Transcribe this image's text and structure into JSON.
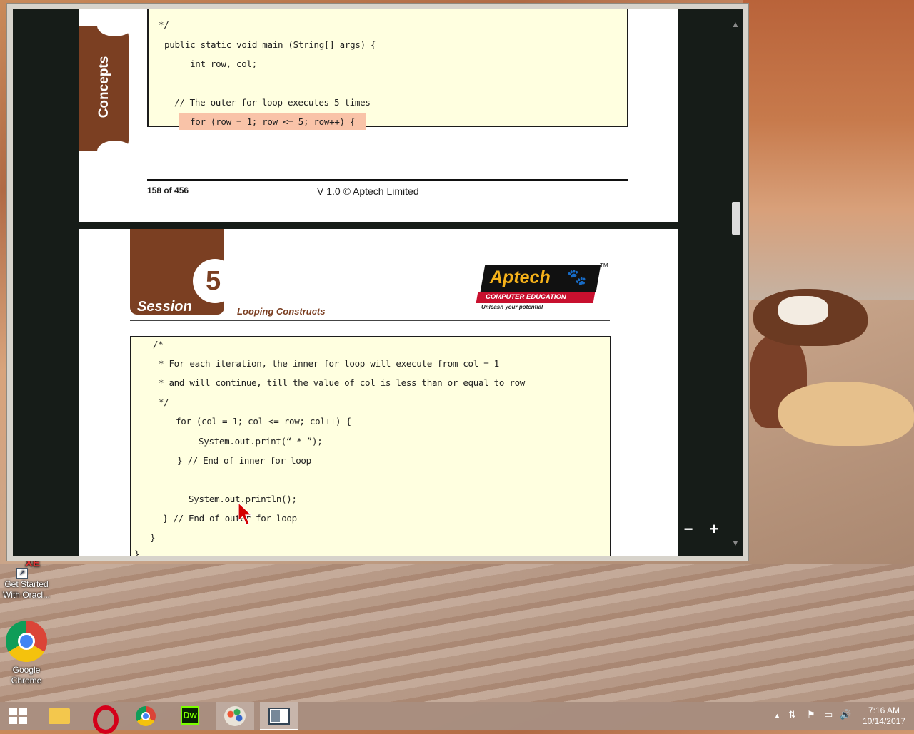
{
  "desktop": {
    "icons": [
      {
        "label_line1": "Get Started",
        "label_line2": "With Oracl..."
      },
      {
        "label_line1": "Google",
        "label_line2": "Chrome"
      }
    ],
    "oracle_badge": "XE"
  },
  "viewer": {
    "zoom_out_label": "−",
    "zoom_in_label": "+",
    "scroll_up": "▲",
    "scroll_down": "▼"
  },
  "page1": {
    "side_tab": "Concepts",
    "code_lines": [
      "*/",
      "public static void main (String[] args) {",
      "int row, col;",
      "// The outer for loop executes 5 times",
      "for (row = 1; row <= 5; row++) {"
    ],
    "page_number": "158 of 456",
    "copyright": "V 1.0 © Aptech Limited"
  },
  "page2": {
    "session_label": "Session",
    "session_number": "5",
    "session_title": "Looping Constructs",
    "logo": {
      "brand": "Aptech",
      "tm": "TM",
      "bar_text": "COMPUTER EDUCATION",
      "tagline": "Unleash your potential"
    },
    "code_lines": [
      "/*",
      "* For each iteration, the inner for loop will execute from col = 1",
      "* and will continue, till the value of col is less than or equal to row",
      "*/",
      "for (col = 1; col <= row; col++) {",
      "System.out.print(“ * ”);",
      "} // End of inner for loop",
      "System.out.println();",
      "} // End of outer for loop",
      "}",
      "}"
    ]
  },
  "taskbar": {
    "apps": [
      "start-icon",
      "file-explorer-icon",
      "opera-icon",
      "chrome-icon",
      "dreamweaver-icon",
      "paint-icon",
      "viewer-icon"
    ],
    "dw_label": "Dw",
    "tray": {
      "up_arrow": "▲",
      "network": "⇅",
      "flag": "⚑",
      "monitor": "▭",
      "volume": "🔊"
    },
    "time": "7:16 AM",
    "date": "10/14/2017"
  },
  "colors": {
    "brown": "#7b3f22",
    "code_bg": "#ffffe0",
    "highlight": "#f9c3a8",
    "logo_yellow": "#f6b21a",
    "logo_red": "#c8102e"
  }
}
